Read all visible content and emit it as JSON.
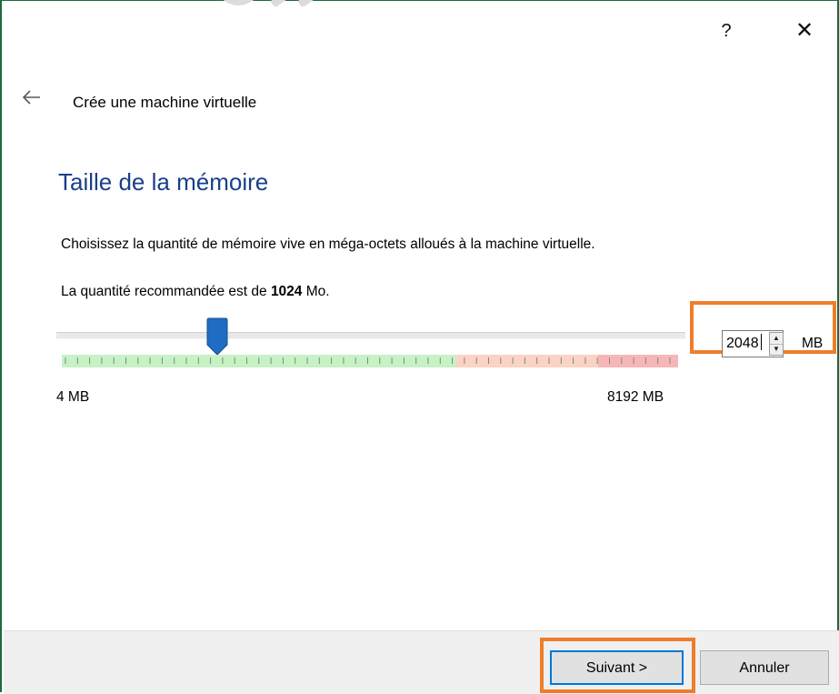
{
  "titlebar": {
    "help_label": "?",
    "close_label": "✕"
  },
  "header": {
    "back_icon": "arrow-left-icon",
    "title": "Crée une machine virtuelle"
  },
  "page": {
    "section_title": "Taille de la mémoire",
    "description": "Choisissez la quantité de mémoire vive en méga-octets alloués à la machine virtuelle.",
    "recommended_prefix": "La quantité recommandée est de ",
    "recommended_value": "1024",
    "recommended_suffix": " Mo."
  },
  "memory": {
    "value": 2048,
    "value_text": "2048",
    "min": 4,
    "max": 8192,
    "min_label": "4 MB",
    "max_label": "8192 MB",
    "unit": "MB",
    "green_fraction": 0.64,
    "orange_fraction": 0.23,
    "red_fraction": 0.13,
    "colors": {
      "green": "#c6f2c6",
      "orange": "#fbd3c4",
      "red": "#f7b6b6",
      "thumb": "#1f6cc4",
      "highlight": "#ee7d2b"
    }
  },
  "footer": {
    "next_label": "Suivant >",
    "cancel_label": "Annuler"
  }
}
